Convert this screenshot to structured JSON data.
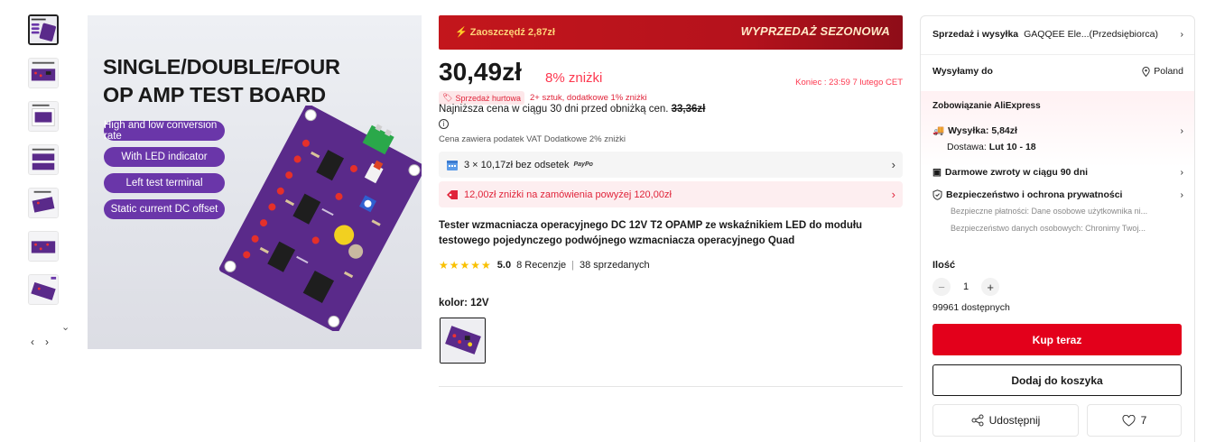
{
  "gallery": {
    "thumbnail_count": 7,
    "nav_prev": "‹",
    "nav_next": "›",
    "scroll_down": "⌄"
  },
  "main_image": {
    "title_line1": "SINGLE/DOUBLE/FOUR",
    "title_line2": "OP AMP TEST BOARD",
    "features": [
      "High and low conversion rate",
      "With LED indicator",
      "Left test terminal",
      "Static current DC offset"
    ]
  },
  "promo": {
    "savings": "⚡ Zaoszczędź 2,87zł",
    "campaign": "WYPRZEDAŻ SEZONOWA"
  },
  "price": {
    "current": "30,49zł",
    "discount": "8% zniżki",
    "ends_label": "Koniec :",
    "ends_time": "23:59 7 lutego CET",
    "bulk_badge": "Sprzedaż hurtowa",
    "bulk_text": "2+ sztuk, dodatkowe 1% zniżki",
    "lowest_label": "Najniższa cena w ciągu 30 dni przed obniżką cen.",
    "lowest_value": "33,36zł",
    "vat": "Cena zawiera podatek VAT Dodatkowe 2% zniżki"
  },
  "installments": {
    "text": "3 × 10,17zł bez odsetek",
    "provider": "PayPo"
  },
  "coupon": {
    "text": "12,00zł zniżki na zamówienia powyżej 120,00zł"
  },
  "product": {
    "title": "Tester wzmacniacza operacyjnego DC 12V T2 OPAMP ze wskaźnikiem LED do modułu testowego pojedynczego podwójnego wzmacniacza operacyjnego Quad",
    "stars": "★★★★★",
    "score": "5.0",
    "reviews": "8 Recenzje",
    "separator": "|",
    "sold": "38 sprzedanych",
    "color_label": "kolor: 12V"
  },
  "panel": {
    "seller_label": "Sprzedaż i wysyłka",
    "seller_name": "GAQQEE Ele...(Przedsiębiorca)",
    "ship_to_label": "Wysyłamy do",
    "ship_to_value": "Poland",
    "commitment_title": "Zobowiązanie AliExpress",
    "shipping": "Wysyłka: 5,84zł",
    "delivery_label": "Dostawa:",
    "delivery_value": "Lut 10 - 18",
    "returns": "Darmowe zwroty w ciągu 90 dni",
    "security": "Bezpieczeństwo i ochrona prywatności",
    "security_note1": "Bezpieczne płatności: Dane osobowe użytkownika ni...",
    "security_note2": "Bezpieczeństwo danych osobowych: Chronimy Twoj...",
    "qty_label": "Ilość",
    "qty_value": "1",
    "qty_minus": "−",
    "qty_plus": "+",
    "available": "99961 dostępnych",
    "buy_now": "Kup teraz",
    "add_to_cart": "Dodaj do koszyka",
    "share": "Udostępnij",
    "wishlist_count": "7"
  },
  "colors": {
    "accent_red": "#e3001b",
    "price_red": "#fd384f",
    "board_purple": "#5a2a8a",
    "feature_pill": "#6a36a9"
  }
}
